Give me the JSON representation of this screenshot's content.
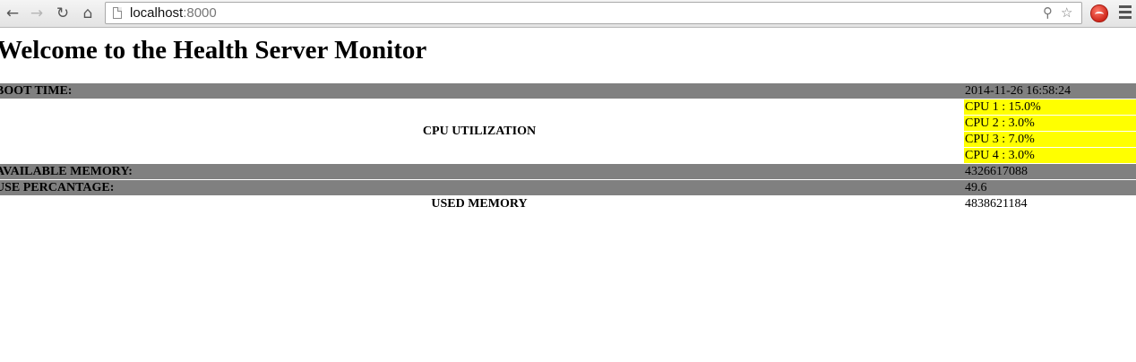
{
  "browser": {
    "url_host": "localhost",
    "url_port": ":8000"
  },
  "page": {
    "title": "Welcome to the Health Server Monitor",
    "boot_time_label": "BOOT TIME:",
    "boot_time_value": "2014-11-26 16:58:24",
    "cpu_label": "CPU UTILIZATION",
    "cpus": [
      "CPU 1 : 15.0%",
      "CPU 2 : 3.0%",
      "CPU 3 : 7.0%",
      "CPU 4 : 3.0%"
    ],
    "available_memory_label": "AVAILABLE MEMORY:",
    "available_memory_value": "4326617088",
    "use_percentage_label": "USE PERCANTAGE:",
    "use_percentage_value": "49.6",
    "used_memory_label": "USED MEMORY",
    "used_memory_value": "4838621184"
  },
  "colors": {
    "gray_row": "#808080",
    "cpu_highlight": "#ffff00"
  }
}
